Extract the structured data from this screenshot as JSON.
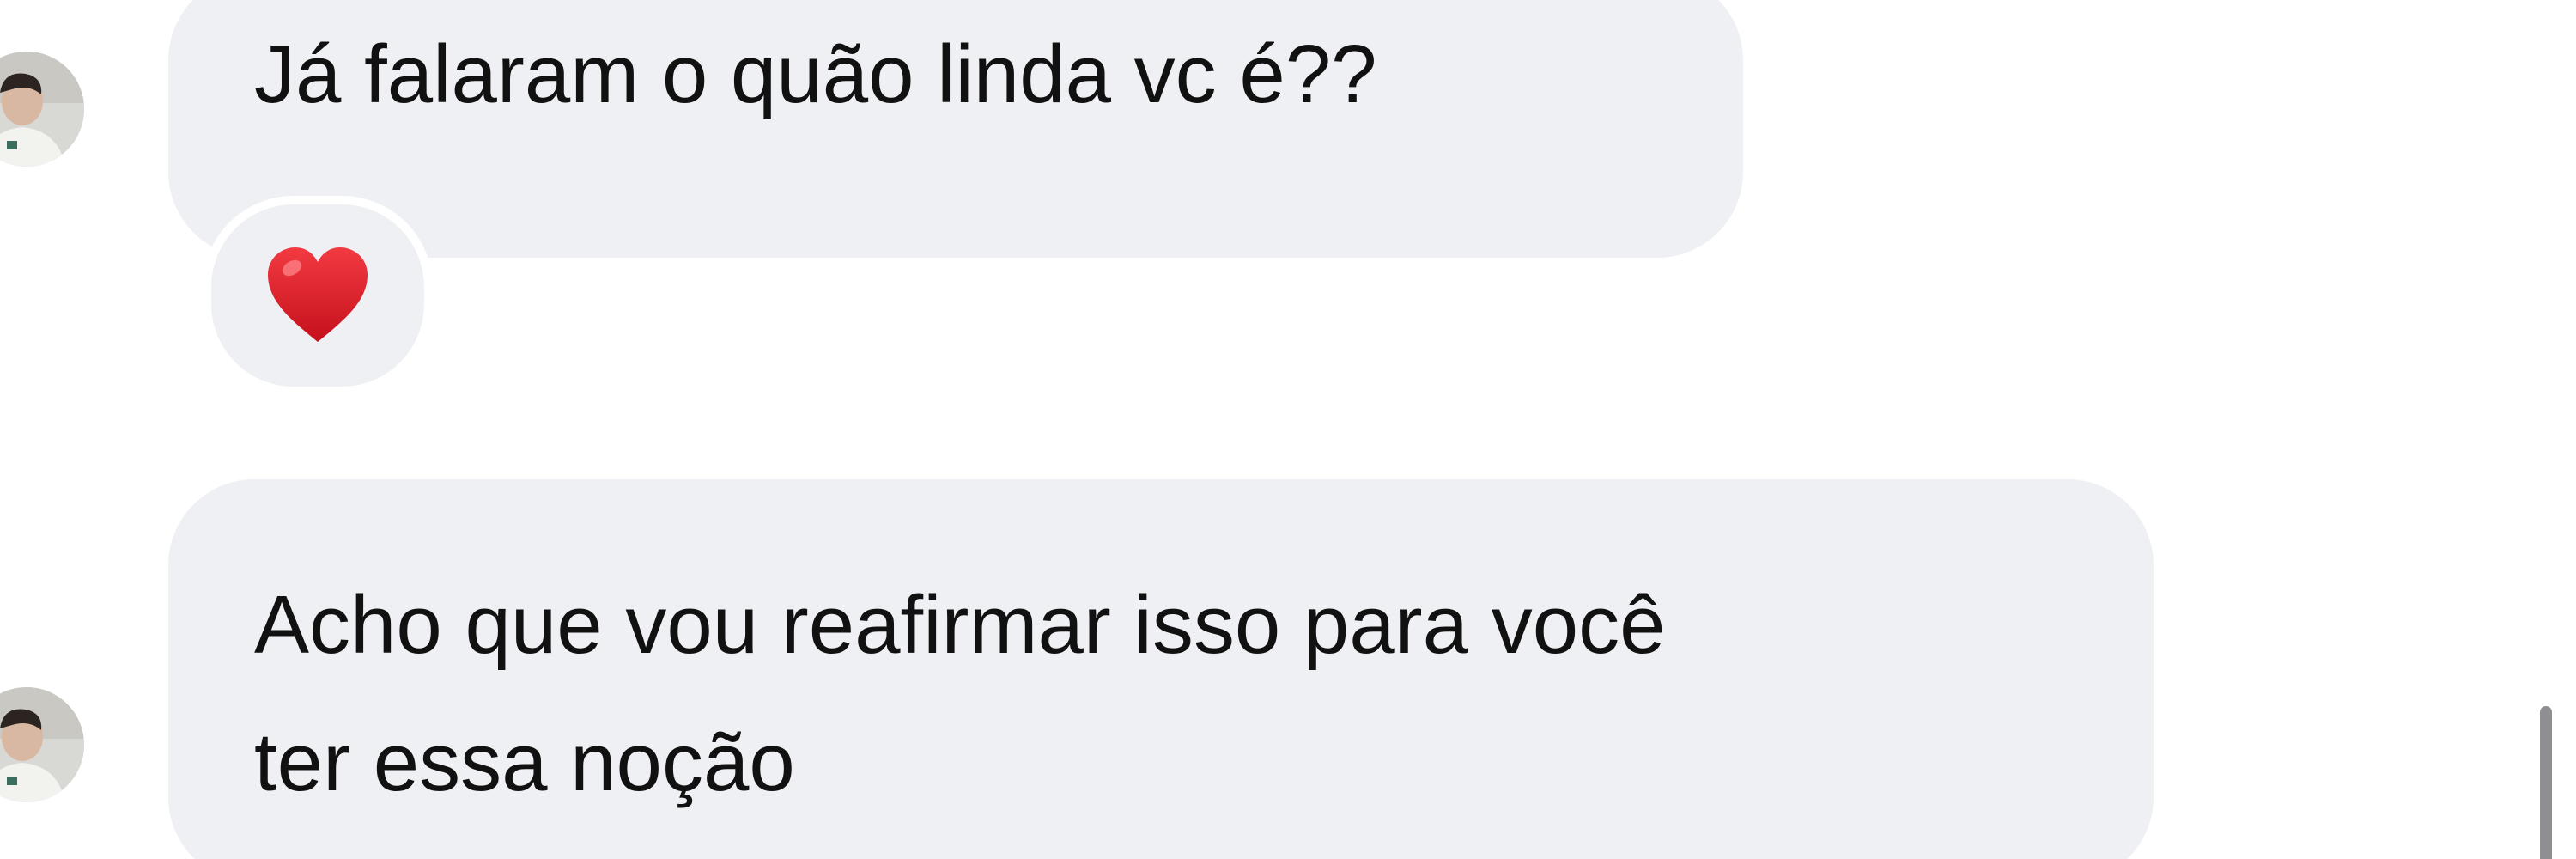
{
  "conversation": {
    "messages": [
      {
        "sender": "other",
        "avatar_icon": "profile-photo-icon",
        "lines": [
          "Já falaram o quão linda vc é??"
        ],
        "reaction": {
          "emoji": "❤️",
          "icon": "red-heart-icon"
        }
      },
      {
        "sender": "other",
        "avatar_icon": "profile-photo-icon",
        "lines": [
          "Acho que vou reafirmar isso para você",
          "ter essa noção"
        ]
      }
    ]
  },
  "colors": {
    "bubble_background": "#eff0f4",
    "text": "#111111",
    "heart": "#e2242e",
    "scrollbar": "#8e8e93",
    "background": "#ffffff"
  }
}
